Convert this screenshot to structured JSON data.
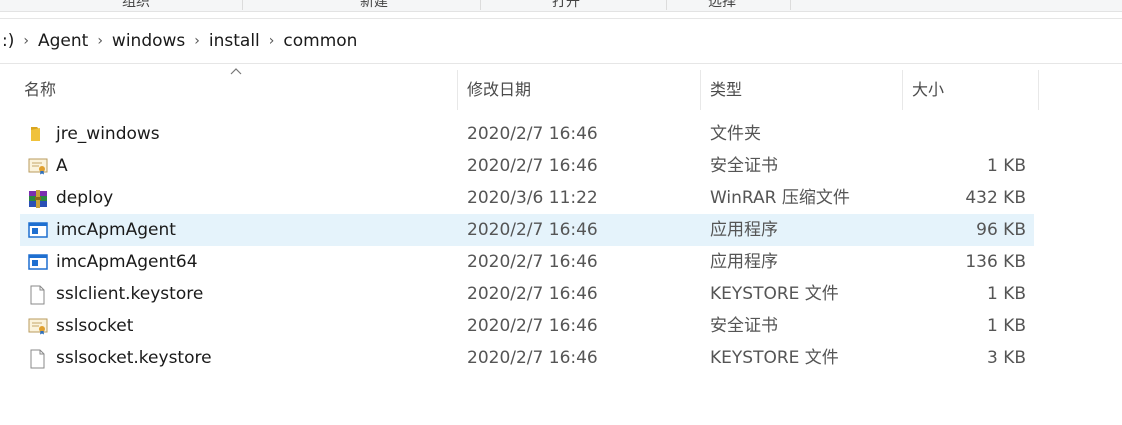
{
  "ribbon": {
    "labels": [
      "组织",
      "新建",
      "打开",
      "选择"
    ]
  },
  "address": {
    "partial": ":)",
    "crumbs": [
      "Agent",
      "windows",
      "install",
      "common"
    ]
  },
  "columns": {
    "name": "名称",
    "date": "修改日期",
    "type": "类型",
    "size": "大小"
  },
  "files": [
    {
      "icon": "folder-icon",
      "name": "jre_windows",
      "date": "2020/2/7 16:46",
      "type": "文件夹",
      "size": ""
    },
    {
      "icon": "certificate-icon",
      "name": "A",
      "date": "2020/2/7 16:46",
      "type": "安全证书",
      "size": "1 KB"
    },
    {
      "icon": "winrar-archive-icon",
      "name": "deploy",
      "date": "2020/3/6 11:22",
      "type": "WinRAR 压缩文件",
      "size": "432 KB"
    },
    {
      "icon": "application-icon",
      "name": "imcApmAgent",
      "date": "2020/2/7 16:46",
      "type": "应用程序",
      "size": "96 KB"
    },
    {
      "icon": "application-icon",
      "name": "imcApmAgent64",
      "date": "2020/2/7 16:46",
      "type": "应用程序",
      "size": "136 KB"
    },
    {
      "icon": "file-icon",
      "name": "sslclient.keystore",
      "date": "2020/2/7 16:46",
      "type": "KEYSTORE 文件",
      "size": "1 KB"
    },
    {
      "icon": "certificate-icon",
      "name": "sslsocket",
      "date": "2020/2/7 16:46",
      "type": "安全证书",
      "size": "1 KB"
    },
    {
      "icon": "file-icon",
      "name": "sslsocket.keystore",
      "date": "2020/2/7 16:46",
      "type": "KEYSTORE 文件",
      "size": "3 KB"
    }
  ],
  "selected_row": "imcApmAgent",
  "colors": {
    "selection": "#e5f3fb",
    "folder": "#f0c23b",
    "app_blue": "#1e6fd0"
  }
}
